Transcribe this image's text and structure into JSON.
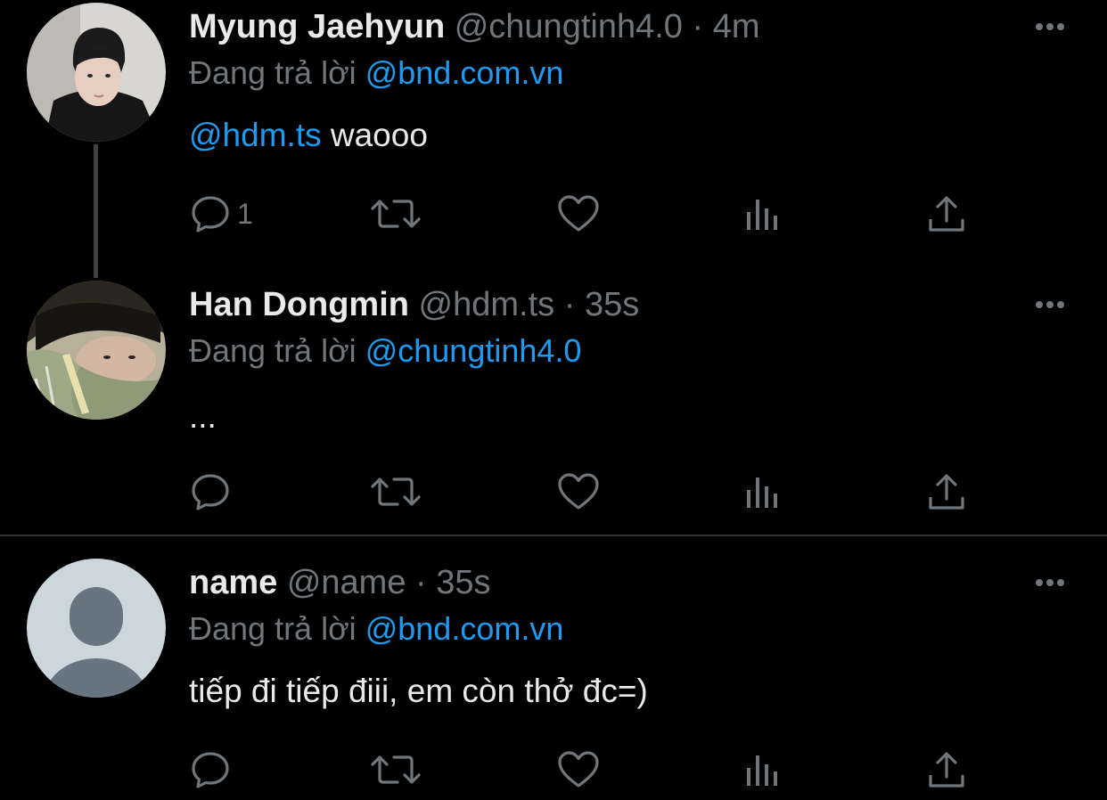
{
  "colors": {
    "background": "#000000",
    "text": "#e7e9ea",
    "muted": "#71767b",
    "link": "#1d9bf0",
    "divider": "#2f3336"
  },
  "tweets": [
    {
      "name": "Myung Jaehyun",
      "handle": "@chungtinh4.0",
      "sep": "·",
      "time": "4m",
      "reply_prefix": "Đang trả lời",
      "reply_to": "@bnd.com.vn",
      "body_mention": "@hdm.ts",
      "body_text": " waooo",
      "reply_count": "1",
      "avatar": "photo-person-dark-hoodie"
    },
    {
      "name": "Han Dongmin",
      "handle": "@hdm.ts",
      "sep": "·",
      "time": "35s",
      "reply_prefix": "Đang trả lời",
      "reply_to": "@chungtinh4.0",
      "body_text": "...",
      "reply_count": "",
      "avatar": "photo-person-zip-jacket"
    },
    {
      "name": "name",
      "handle": "@name",
      "sep": "·",
      "time": "35s",
      "reply_prefix": "Đang trả lời",
      "reply_to": "@bnd.com.vn",
      "body_text": "tiếp đi tiếp điii, em còn thở đc=)",
      "reply_count": "",
      "avatar": "default-avatar-placeholder"
    }
  ],
  "icons": {
    "more": "more-dots-icon",
    "reply": "reply-bubble-icon",
    "retweet": "retweet-icon",
    "like": "heart-icon",
    "views": "views-chart-icon",
    "share": "share-icon"
  }
}
